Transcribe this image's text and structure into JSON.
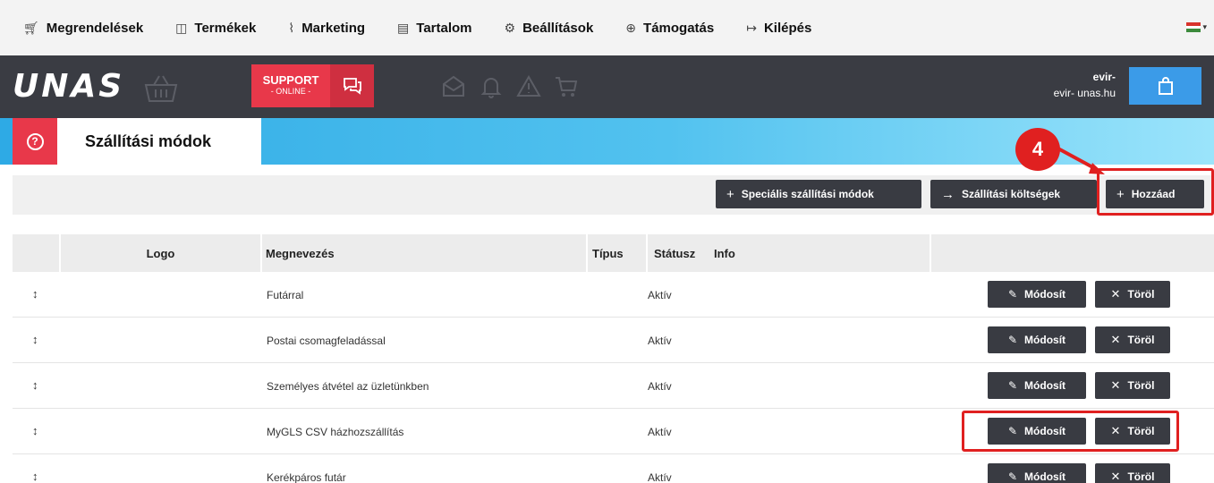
{
  "topnav": {
    "items": [
      {
        "icon": "cart-icon",
        "glyph": "🛒︎",
        "label": "Megrendelések"
      },
      {
        "icon": "box-icon",
        "glyph": "◫",
        "label": "Termékek"
      },
      {
        "icon": "chart-icon",
        "glyph": "⌇",
        "label": "Marketing"
      },
      {
        "icon": "document-icon",
        "glyph": "▤",
        "label": "Tartalom"
      },
      {
        "icon": "gear-icon",
        "glyph": "⚙",
        "label": "Beállítások"
      },
      {
        "icon": "lifebuoy-icon",
        "glyph": "⊕",
        "label": "Támogatás"
      },
      {
        "icon": "logout-icon",
        "glyph": "↦",
        "label": "Kilépés"
      }
    ],
    "flag_colors": [
      "#d8332c",
      "#ffffff",
      "#3c8a3c"
    ]
  },
  "header": {
    "logo": "UNAS",
    "support_label": "SUPPORT",
    "support_sub": "- ONLINE -",
    "user_name": "evir-",
    "user_email": "evir-          unas.hu"
  },
  "title": {
    "help_glyph": "?",
    "page_title": "Szállítási módok"
  },
  "toolbar": {
    "special_label": "Speciális szállítási módok",
    "costs_label": "Szállítási költségek",
    "add_label": "Hozzáad"
  },
  "callout": {
    "number": "4"
  },
  "table": {
    "headers": {
      "logo": "Logo",
      "name": "Megnevezés",
      "type": "Típus",
      "status": "Státusz",
      "info": "Info"
    },
    "rows": [
      {
        "name": "Futárral",
        "status": "Aktív",
        "edit": "Módosít",
        "delete": "Töröl"
      },
      {
        "name": "Postai csomagfeladással",
        "status": "Aktív",
        "edit": "Módosít",
        "delete": "Töröl"
      },
      {
        "name": "Személyes átvétel az üzletünkben",
        "status": "Aktív",
        "edit": "Módosít",
        "delete": "Töröl"
      },
      {
        "name": "MyGLS CSV házhozszállítás",
        "status": "Aktív",
        "edit": "Módosít",
        "delete": "Töröl"
      },
      {
        "name": "Kerékpáros futár",
        "status": "Aktív",
        "edit": "Módosít",
        "delete": "Töröl"
      }
    ]
  },
  "colors": {
    "accent_red": "#e8384a",
    "dark": "#393b42",
    "header_bg": "#3a3c43",
    "blue": "#3b9be8",
    "highlight": "#e02020"
  }
}
